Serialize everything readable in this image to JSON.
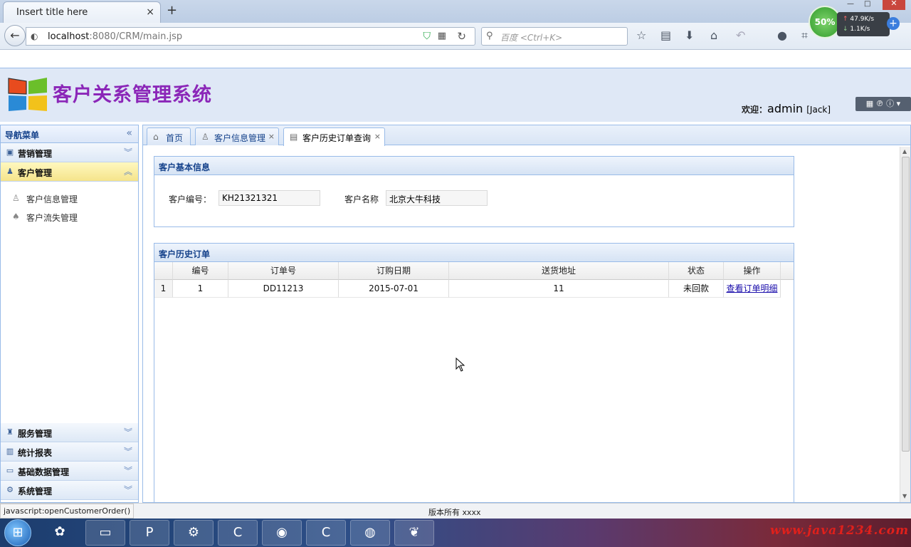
{
  "browser": {
    "tab_title": "Insert title here",
    "tab_close": "×",
    "new_tab": "+",
    "url_host": "localhost",
    "url_rest": ":8080/CRM/main.jsp",
    "search_placeholder": "百度 <Ctrl+K>",
    "net": {
      "percent": "50%",
      "up": "47.9K/s",
      "down": "1.1K/s"
    }
  },
  "header": {
    "system_title": "客户关系管理系统",
    "welcome_label": "欢迎：",
    "user": "admin",
    "nickname": "[Jack]"
  },
  "nav": {
    "title": "导航菜单",
    "sections": [
      {
        "label": "营销管理",
        "icon": "marketing-icon"
      },
      {
        "label": "客户管理",
        "icon": "customer-icon",
        "active": true
      },
      {
        "label": "服务管理",
        "icon": "service-icon"
      },
      {
        "label": "统计报表",
        "icon": "report-icon"
      },
      {
        "label": "基础数据管理",
        "icon": "database-icon"
      },
      {
        "label": "系统管理",
        "icon": "gear-icon"
      }
    ],
    "customer_items": [
      {
        "label": "客户信息管理",
        "icon": "customer-info-icon"
      },
      {
        "label": "客户流失管理",
        "icon": "customer-loss-icon"
      }
    ]
  },
  "tabs": [
    {
      "label": "首页",
      "icon": "home-icon",
      "closable": false
    },
    {
      "label": "客户信息管理",
      "icon": "customer-info-icon",
      "closable": true
    },
    {
      "label": "客户历史订单查询",
      "icon": "order-history-icon",
      "closable": true,
      "active": true
    }
  ],
  "basic_info": {
    "title": "客户基本信息",
    "customer_no_label": "客户编号：",
    "customer_no": "KH21321321",
    "customer_name_label": "客户名称",
    "customer_name": "北京大牛科技"
  },
  "orders": {
    "title": "客户历史订单",
    "columns": [
      "编号",
      "订单号",
      "订购日期",
      "送货地址",
      "状态",
      "操作"
    ],
    "rows": [
      {
        "row_num": "1",
        "id": "1",
        "order_no": "DD11213",
        "date": "2015-07-01",
        "address": "11",
        "status": "未回款",
        "action": "查看订单明细"
      }
    ]
  },
  "status": {
    "url": "javascript:openCustomerOrder()",
    "copyright": "版本所有 xxxx"
  },
  "watermark": "www.java1234.com",
  "colors": {
    "accent": "#15428b",
    "title": "#8b26b8",
    "active_nav": "#f5e48b",
    "border": "#99bbe8"
  }
}
